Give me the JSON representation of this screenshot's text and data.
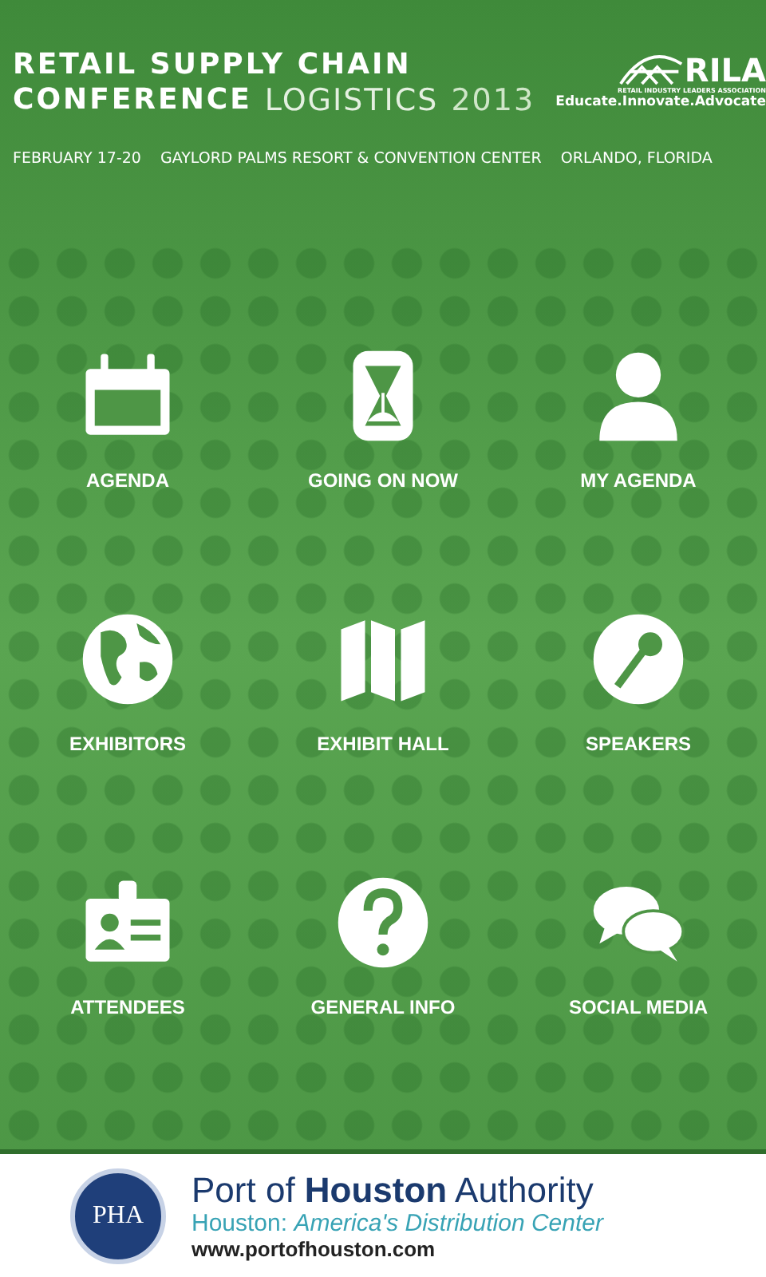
{
  "header": {
    "title_line_1": "RETAIL SUPPLY CHAIN",
    "title_line_2_bold": "CONFERENCE",
    "title_line_2_light": "LOGISTICS",
    "year": "2013",
    "logo": {
      "name": "RILA",
      "tagline": "RETAIL INDUSTRY LEADERS ASSOCIATION",
      "motto": "Educate.Innovate.Advocate"
    },
    "dates": "FEBRUARY 17-20",
    "venue": "GAYLORD PALMS RESORT & CONVENTION CENTER",
    "city": "ORLANDO, FLORIDA"
  },
  "menu": [
    {
      "label": "AGENDA",
      "kind": "calendar"
    },
    {
      "label": "GOING ON NOW",
      "kind": "hourglass"
    },
    {
      "label": "MY AGENDA",
      "kind": "person"
    },
    {
      "label": "EXHIBITORS",
      "kind": "globe"
    },
    {
      "label": "EXHIBIT HALL",
      "kind": "map"
    },
    {
      "label": "SPEAKERS",
      "kind": "microphone"
    },
    {
      "label": "ATTENDEES",
      "kind": "badge"
    },
    {
      "label": "GENERAL INFO",
      "kind": "question"
    },
    {
      "label": "SOCIAL MEDIA",
      "kind": "chat"
    }
  ],
  "sponsor": {
    "seal": "PHA",
    "name": "Port of **Houston** Authority",
    "tagline": "Houston: *America's Distribution Center*",
    "url": "www.portofhouston.com"
  }
}
